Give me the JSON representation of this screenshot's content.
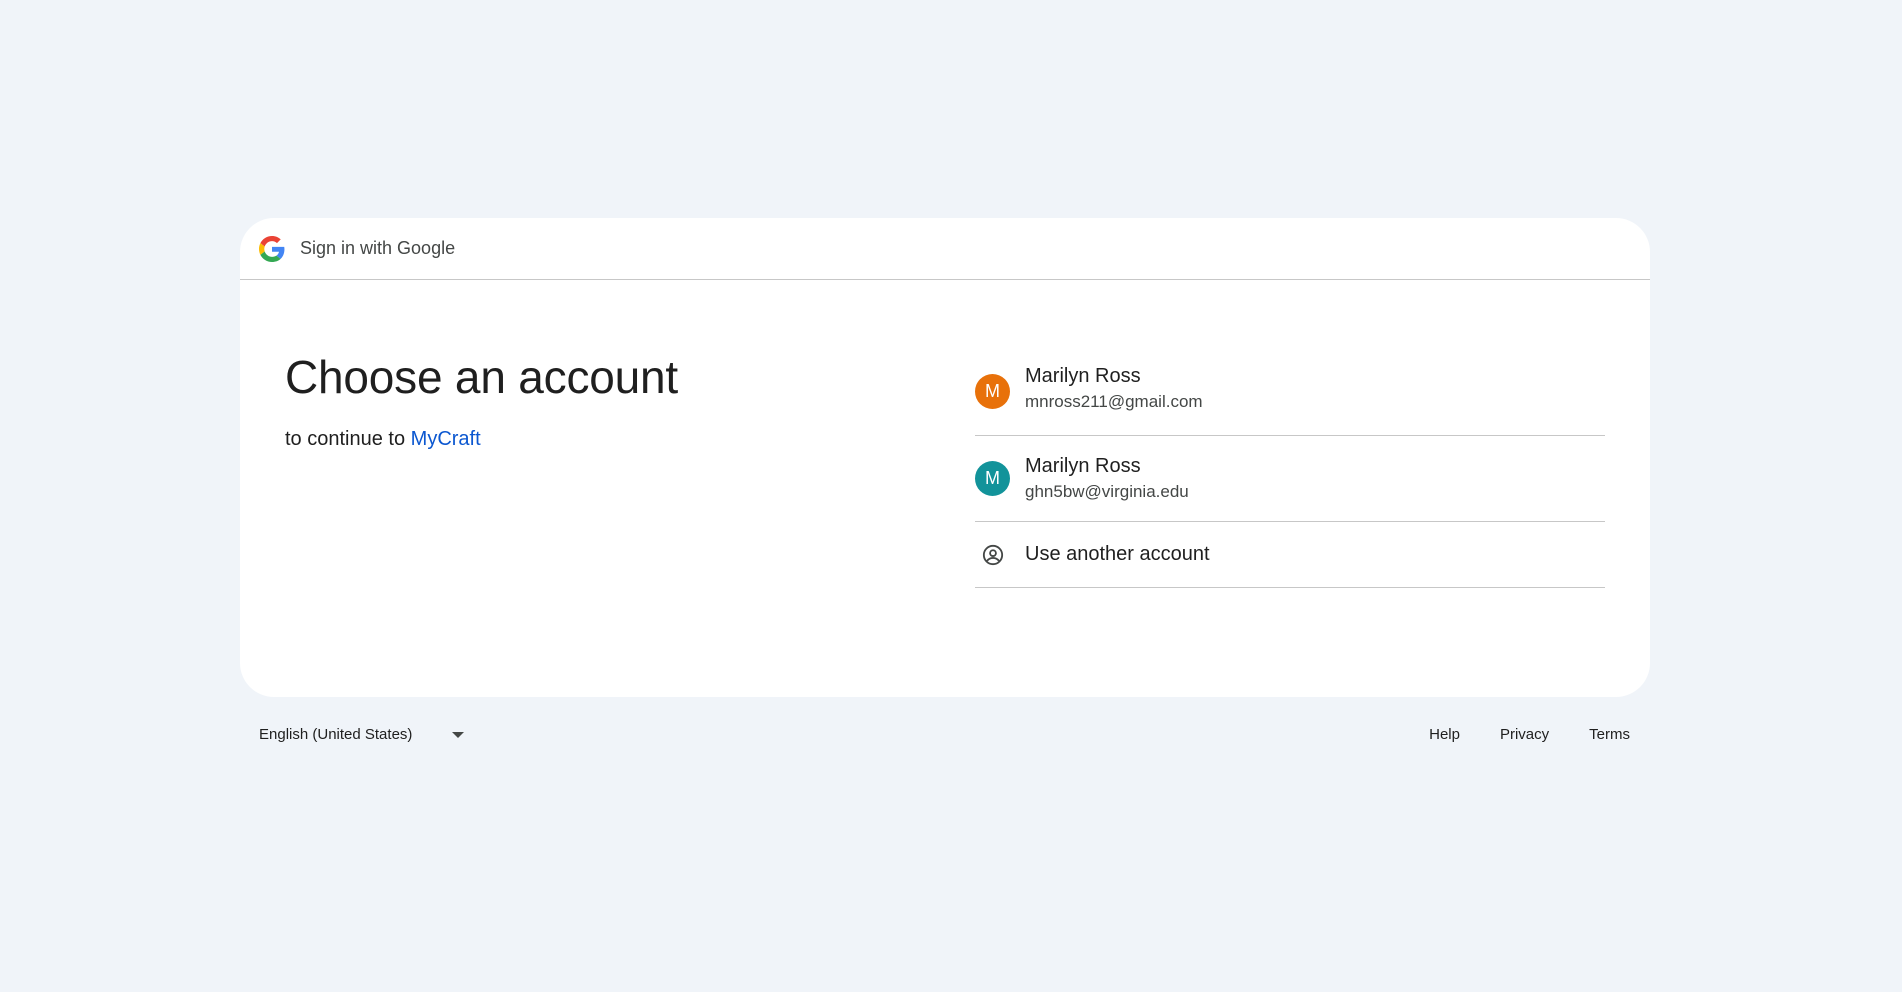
{
  "header": {
    "title": "Sign in with Google",
    "logo_icon": "google-g-icon"
  },
  "main": {
    "title": "Choose an account",
    "subtitle_prefix": "to continue to",
    "app_name": "MyCraft"
  },
  "accounts": [
    {
      "initial": "M",
      "name": "Marilyn Ross",
      "email": "mnross211@gmail.com",
      "avatar_color": "#e8710a"
    },
    {
      "initial": "M",
      "name": "Marilyn Ross",
      "email": "ghn5bw@virginia.edu",
      "avatar_color": "#12939a"
    }
  ],
  "other_account": {
    "label": "Use another account",
    "icon": "account-circle-icon"
  },
  "footer": {
    "language": "English (United States)",
    "links": [
      "Help",
      "Privacy",
      "Terms"
    ]
  },
  "colors": {
    "background": "#f0f4f9",
    "card": "#ffffff",
    "link": "#0b57d0",
    "divider": "#c7c7c7"
  }
}
